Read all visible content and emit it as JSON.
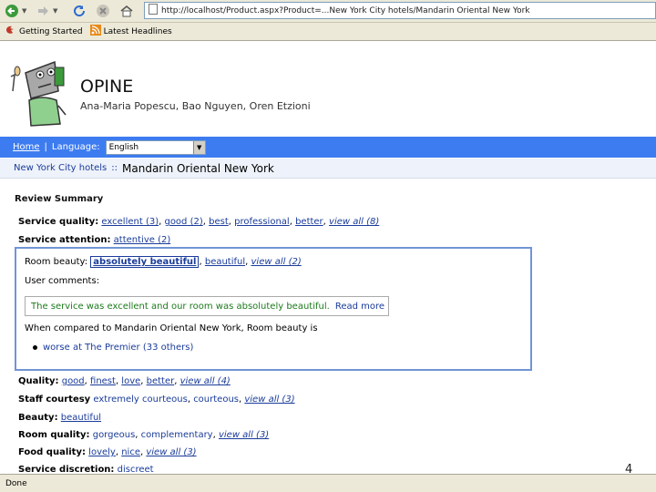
{
  "browser": {
    "url": "http://localhost/Product.aspx?Product=...New York City hotels/Mandarin Oriental New York",
    "bookmarks": [
      "Getting Started",
      "Latest Headlines"
    ],
    "status": "Done"
  },
  "header": {
    "title": "OPINE",
    "authors": "Ana-Maria Popescu, Bao Nguyen, Oren Etzioni"
  },
  "nav": {
    "home": "Home",
    "separator": "|",
    "language_label": "Language:",
    "language_value": "English"
  },
  "breadcrumb": {
    "parent": "New York City hotels",
    "separator": "::",
    "current": "Mandarin Oriental New York"
  },
  "summary": {
    "title": "Review Summary",
    "service_quality": {
      "label": "Service quality:",
      "links": [
        "excellent (3)",
        "good (2)",
        "best",
        "professional",
        "better"
      ],
      "view_all": "view all (8)"
    },
    "service_attention": {
      "label": "Service attention:",
      "links": [
        "attentive (2)"
      ]
    },
    "room_beauty": {
      "label": "Room beauty:",
      "highlighted": "absolutely beautiful",
      "links": [
        "beautiful"
      ],
      "view_all": "view all (2)",
      "comments_label": "User comments:",
      "comment": "The service was excellent and our room was absolutely beautiful.",
      "read_more": "Read more",
      "comparison": "When compared to Mandarin Oriental New York, Room beauty is",
      "comparison_item": "worse at The Premier (33 others)"
    },
    "quality": {
      "label": "Quality:",
      "links": [
        "good",
        "finest",
        "love",
        "better"
      ],
      "view_all": "view all (4)"
    },
    "staff_courtesy": {
      "label": "Staff courtesy",
      "values": [
        "extremely courteous",
        "courteous"
      ],
      "view_all": "view all (3)"
    },
    "beauty": {
      "label": "Beauty:",
      "links": [
        "beautiful"
      ]
    },
    "room_quality": {
      "label": "Room quality:",
      "values": [
        "gorgeous",
        "complementary"
      ],
      "view_all": "view all (3)"
    },
    "food_quality": {
      "label": "Food quality:",
      "links": [
        "lovely",
        "nice"
      ],
      "view_all": "view all (3)"
    },
    "service_discretion": {
      "label": "Service discretion:",
      "values": [
        "discreet"
      ]
    }
  },
  "slide_number": "4",
  "colors": {
    "nav_bar": "#3d7cf0",
    "link": "#1a3c9a",
    "comment_text": "#1c7a1c",
    "panel_border": "#6f95d4"
  }
}
